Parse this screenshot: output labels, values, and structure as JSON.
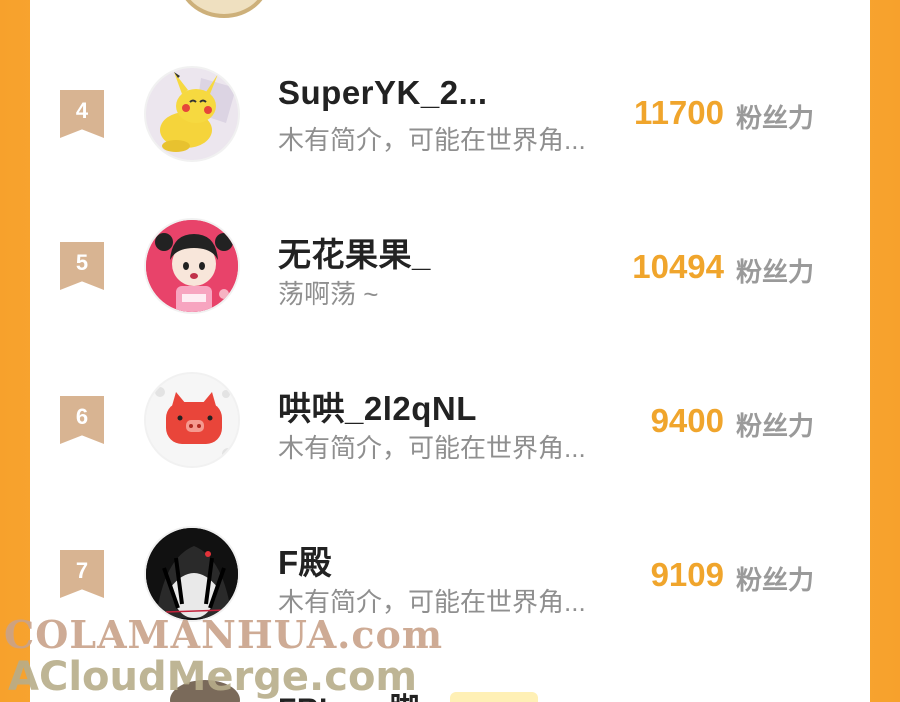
{
  "leaderboard": {
    "rows": [
      {
        "rank": "4",
        "name": "SuperYK_2...",
        "bio": "木有简介，可能在世界角...",
        "score": "11700",
        "unit": "粉丝力",
        "avatar_icon": "pikachu-avatar-icon"
      },
      {
        "rank": "5",
        "name": "无花果果_",
        "bio": "荡啊荡 ~",
        "score": "10494",
        "unit": "粉丝力",
        "avatar_icon": "girl-avatar-icon"
      },
      {
        "rank": "6",
        "name": "哄哄_2l2qNL",
        "bio": "木有简介，可能在世界角...",
        "score": "9400",
        "unit": "粉丝力",
        "avatar_icon": "pig-avatar-icon"
      },
      {
        "rank": "7",
        "name": "F殿",
        "bio": "木有简介，可能在世界角...",
        "score": "9109",
        "unit": "粉丝力",
        "avatar_icon": "anime-dark-avatar-icon"
      }
    ],
    "partial_row": {
      "name": "FRL___脚"
    }
  },
  "watermarks": {
    "line1": "COLAMANHUA.com",
    "line2": "ACloudMerge.com"
  },
  "colors": {
    "accent": "#f0a52c",
    "badge": "#d8b492",
    "background": "#fcbc49"
  }
}
